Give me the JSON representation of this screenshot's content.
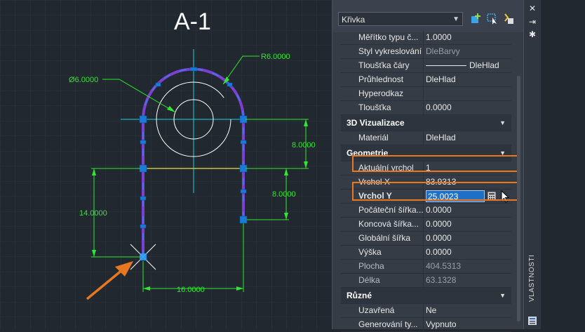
{
  "drawing": {
    "title": "A-1",
    "dimensions": {
      "radius": "R6.0000",
      "diameter": "Ø6.0000",
      "right_upper": "8.0000",
      "right_lower": "8.0000",
      "left_vertical": "14.0000",
      "bottom": "16.0000"
    },
    "colors": {
      "polyline": "#7b3fd1",
      "dimension": "#2fe82f",
      "grip": "#1a7ad8",
      "centerline": "#22d0e0",
      "arrow": "#e87722"
    }
  },
  "panel": {
    "object_type": "Křivka",
    "toolbar_icons": [
      "add-to-selection-icon",
      "select-objects-icon",
      "quick-select-icon"
    ],
    "rows_general": [
      {
        "name": "Měřítko typu č...",
        "value": "1.0000"
      },
      {
        "name": "Styl vykreslování",
        "value": "DleBarvy"
      },
      {
        "name": "Tloušťka čáry",
        "value": "DleHlad"
      },
      {
        "name": "Průhlednost",
        "value": "DleHlad"
      },
      {
        "name": "Hyperodkaz",
        "value": ""
      },
      {
        "name": "Tloušťka",
        "value": "0.0000"
      }
    ],
    "cat_3d": "3D Vizualizace",
    "rows_3d": [
      {
        "name": "Materiál",
        "value": "DleHlad"
      }
    ],
    "cat_geometry": "Geometrie",
    "rows_geometry": [
      {
        "name": "Aktuální vrchol",
        "value": "1"
      },
      {
        "name": "Vrchol X",
        "value": "83.9313"
      },
      {
        "name": "Vrchol Y",
        "value": "25.0023"
      },
      {
        "name": "Počáteční šířka...",
        "value": "0.0000"
      },
      {
        "name": "Koncová šířka...",
        "value": "0.0000"
      },
      {
        "name": "Globální šířka",
        "value": "0.0000"
      },
      {
        "name": "Výška",
        "value": "0.0000"
      },
      {
        "name": "Plocha",
        "value": "404.5313"
      },
      {
        "name": "Délka",
        "value": "63.1328"
      }
    ],
    "cat_misc": "Různé",
    "rows_misc": [
      {
        "name": "Uzavřená",
        "value": "Ne"
      },
      {
        "name": "Generování ty...",
        "value": "Vypnuto"
      }
    ]
  },
  "side_strip": {
    "title": "VLASTNOSTI",
    "icons": [
      "close-icon",
      "auto-hide-icon",
      "settings-icon",
      "properties-icon"
    ]
  }
}
